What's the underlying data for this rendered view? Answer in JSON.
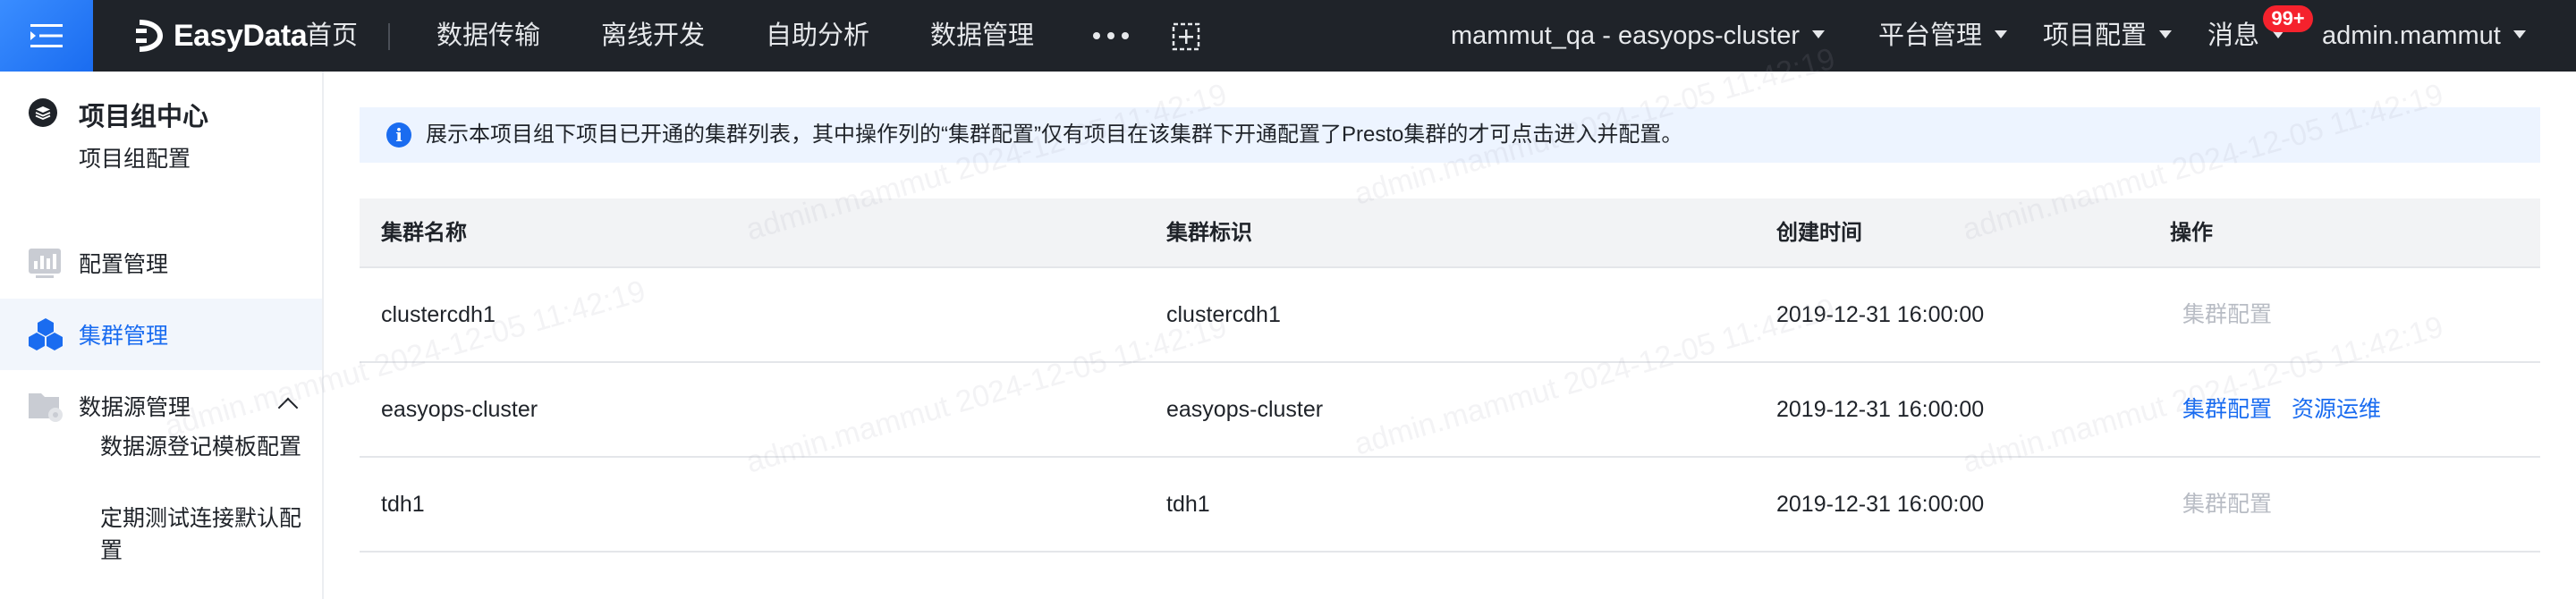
{
  "brand": {
    "name": "EasyData"
  },
  "nav": {
    "items": [
      "首页",
      "数据传输",
      "离线开发",
      "自助分析",
      "数据管理"
    ],
    "project": "mammut_qa - easyops-cluster",
    "platform": "平台管理",
    "project_config": "项目配置",
    "messages": "消息",
    "messages_badge": "99+",
    "user": "admin.mammut"
  },
  "sidebar": {
    "title": "项目组中心",
    "subtitle": "项目组配置",
    "items": [
      {
        "label": "配置管理",
        "icon": "settings-panel-icon"
      },
      {
        "label": "集群管理",
        "icon": "cluster-cubes-icon",
        "active": true
      },
      {
        "label": "数据源管理",
        "icon": "datasource-folder-icon",
        "expanded": true
      }
    ],
    "subitems": [
      "数据源登记模板配置",
      "定期测试连接默认配置"
    ]
  },
  "notice": {
    "icon": "info-icon",
    "text": "展示本项目组下项目已开通的集群列表，其中操作列的“集群配置”仅有项目在该集群下开通配置了Presto集群的才可点击进入并配置。"
  },
  "table": {
    "headers": [
      "集群名称",
      "集群标识",
      "创建时间",
      "操作"
    ],
    "rows": [
      {
        "name": "clustercdh1",
        "id": "clustercdh1",
        "created": "2019-12-31 16:00:00",
        "actions": [
          {
            "label": "集群配置",
            "enabled": false
          }
        ]
      },
      {
        "name": "easyops-cluster",
        "id": "easyops-cluster",
        "created": "2019-12-31 16:00:00",
        "actions": [
          {
            "label": "集群配置",
            "enabled": true
          },
          {
            "label": "资源运维",
            "enabled": true
          }
        ]
      },
      {
        "name": "tdh1",
        "id": "tdh1",
        "created": "2019-12-31 16:00:00",
        "actions": [
          {
            "label": "集群配置",
            "enabled": false
          }
        ]
      }
    ]
  },
  "watermark": "admin.mammut 2024-12-05 11:42:19",
  "colors": {
    "accent": "#1a6cf0",
    "topbar": "#1f2329",
    "disabled": "#b8bcc4",
    "badge": "#f5222d"
  }
}
